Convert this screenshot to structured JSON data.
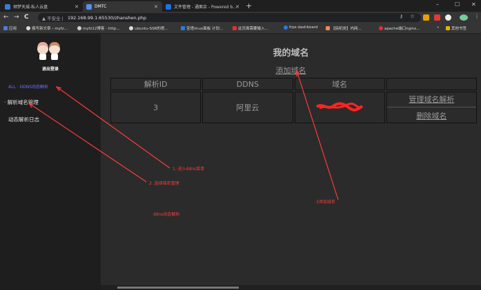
{
  "browser": {
    "tabs": [
      {
        "title": "倾梦天城-私人云盘",
        "active": false,
        "color": "#3a7bd5"
      },
      {
        "title": "DMTC",
        "active": true,
        "color": "#5b8def"
      },
      {
        "title": "文件管理 - 通面余 - Powered b...",
        "active": false,
        "color": "#1a73e8"
      }
    ],
    "new_tab": "+",
    "window_controls": [
      "–",
      "☐",
      "✕"
    ],
    "nav": {
      "back": "←",
      "forward": "→",
      "reload": "C",
      "home": "⌂"
    },
    "security_label": "▲ 不安全 |",
    "url": "192.168.99.1:65530/zhanshen.php",
    "bookmarks": [
      {
        "label": "应用",
        "color": "#4f7ad8"
      },
      {
        "label": "撰写新文章 ‹ myfz...",
        "color": "#dddddd"
      },
      {
        "label": "myfz12博客 - http...",
        "color": "#cfcfcf"
      },
      {
        "label": "ubuntu-SSR的搭...",
        "color": "#dddddd"
      },
      {
        "label": "宝塔linux面板 计划...",
        "color": "#2a7ae2"
      },
      {
        "label": "此页面需要输入...",
        "color": "#d33"
      },
      {
        "label": "frps dashboard",
        "color": "#2a7ae2"
      },
      {
        "label": "【搞机党】内网...",
        "color": "#e85"
      },
      {
        "label": "apache端口nginx...",
        "color": "#d33"
      },
      {
        "label": "»",
        "color": "#353535"
      },
      {
        "label": "其他书签",
        "color": "#e0b400"
      }
    ]
  },
  "sidebar": {
    "logout": "退出登录",
    "menu_top": "ALL  ·  DDNS动态解析",
    "items": [
      "· 解析域名管理",
      "动态解析日志"
    ]
  },
  "main": {
    "title": "我的域名",
    "add_domain": "添加域名",
    "columns": [
      "解析ID",
      "DDNS",
      "域名",
      ""
    ],
    "rows": [
      {
        "id": "3",
        "ddns": "阿里云",
        "domain": "",
        "manage": "管理域名解析",
        "delete": "删除域名"
      }
    ]
  },
  "annotations": [
    "1. 进入ddns菜单",
    "2. 选择域名管理",
    "3添加域名",
    "ddns动态解析"
  ]
}
